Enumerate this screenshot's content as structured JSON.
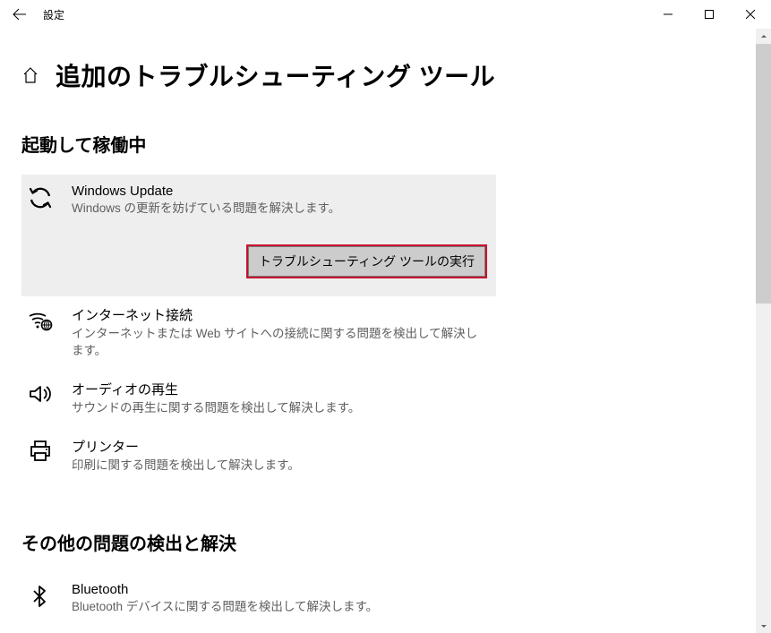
{
  "window": {
    "title": "設定"
  },
  "page": {
    "title": "追加のトラブルシューティング ツール"
  },
  "sections": {
    "s1": {
      "title": "起動して稼働中"
    },
    "s2": {
      "title": "その他の問題の検出と解決"
    }
  },
  "items": {
    "windows_update": {
      "title": "Windows Update",
      "desc": "Windows の更新を妨げている問題を解決します。",
      "run_label": "トラブルシューティング ツールの実行"
    },
    "internet": {
      "title": "インターネット接続",
      "desc": "インターネットまたは Web サイトへの接続に関する問題を検出して解決します。"
    },
    "audio": {
      "title": "オーディオの再生",
      "desc": "サウンドの再生に関する問題を検出して解決します。"
    },
    "printer": {
      "title": "プリンター",
      "desc": "印刷に関する問題を検出して解決します。"
    },
    "bluetooth": {
      "title": "Bluetooth",
      "desc": "Bluetooth デバイスに関する問題を検出して解決します。"
    }
  }
}
